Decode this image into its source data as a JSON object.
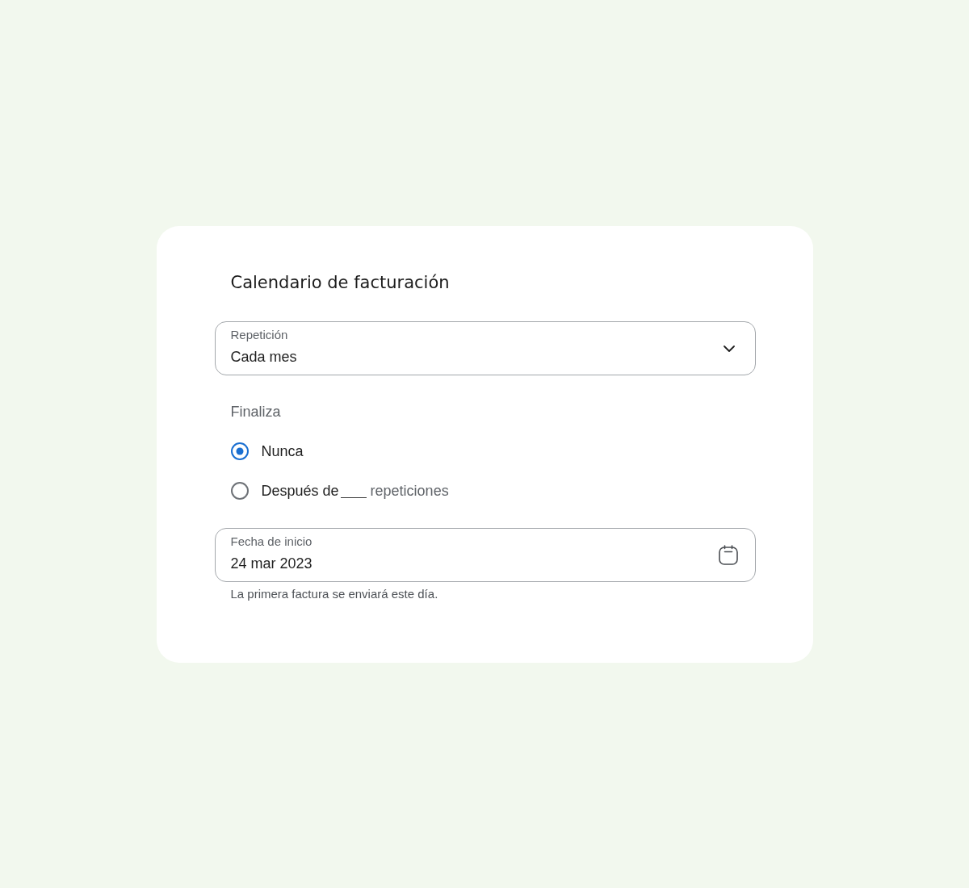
{
  "card": {
    "title": "Calendario de facturación"
  },
  "repetition": {
    "label": "Repetición",
    "value": "Cada mes"
  },
  "ends": {
    "label": "Finaliza",
    "options": [
      {
        "kind": "plain",
        "label": "Nunca",
        "selected": true
      },
      {
        "kind": "count",
        "label": "Después de",
        "suffix": "repeticiones",
        "selected": false
      }
    ]
  },
  "start_date": {
    "label": "Fecha de inicio",
    "value": "24 mar 2023",
    "helper": "La primera factura se enviará este día."
  }
}
